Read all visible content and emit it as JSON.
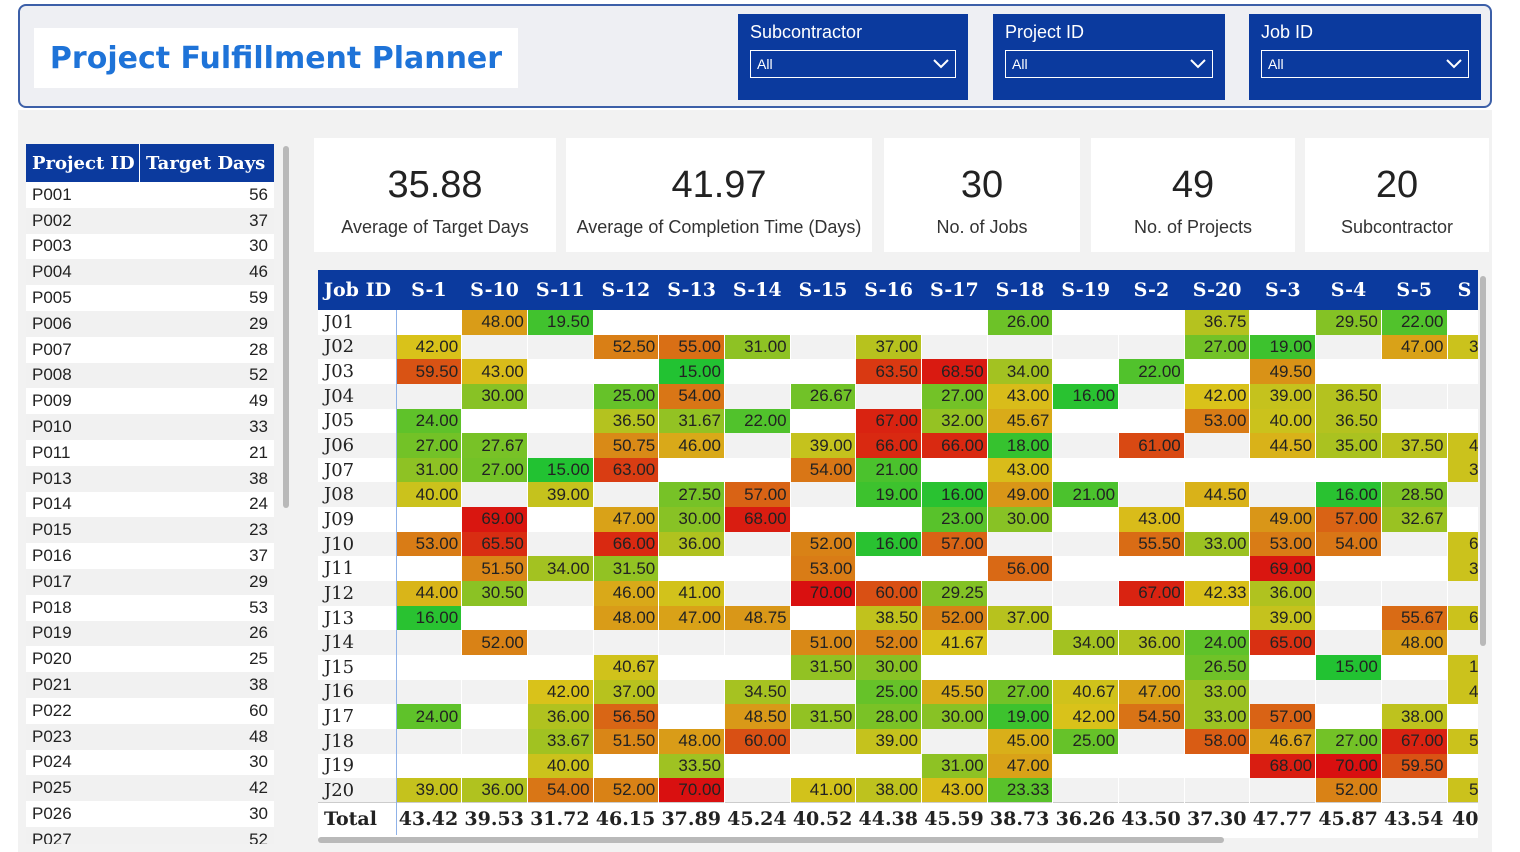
{
  "title": "Project Fulfillment Planner",
  "slicers": [
    {
      "label": "Subcontractor",
      "value": "All"
    },
    {
      "label": "Project ID",
      "value": "All"
    },
    {
      "label": "Job ID",
      "value": "All"
    }
  ],
  "project_table": {
    "headers": [
      "Project ID",
      "Target Days"
    ],
    "rows": [
      [
        "P001",
        "56"
      ],
      [
        "P002",
        "37"
      ],
      [
        "P003",
        "30"
      ],
      [
        "P004",
        "46"
      ],
      [
        "P005",
        "59"
      ],
      [
        "P006",
        "29"
      ],
      [
        "P007",
        "28"
      ],
      [
        "P008",
        "52"
      ],
      [
        "P009",
        "49"
      ],
      [
        "P010",
        "33"
      ],
      [
        "P011",
        "21"
      ],
      [
        "P013",
        "38"
      ],
      [
        "P014",
        "24"
      ],
      [
        "P015",
        "23"
      ],
      [
        "P016",
        "37"
      ],
      [
        "P017",
        "29"
      ],
      [
        "P018",
        "53"
      ],
      [
        "P019",
        "26"
      ],
      [
        "P020",
        "25"
      ],
      [
        "P021",
        "38"
      ],
      [
        "P022",
        "60"
      ],
      [
        "P023",
        "48"
      ],
      [
        "P024",
        "30"
      ],
      [
        "P025",
        "42"
      ],
      [
        "P026",
        "30"
      ],
      [
        "P027",
        "52"
      ]
    ]
  },
  "kpis": [
    {
      "value": "35.88",
      "label": "Average of Target Days"
    },
    {
      "value": "41.97",
      "label": "Average of Completion Time (Days)"
    },
    {
      "value": "30",
      "label": "No. of Jobs"
    },
    {
      "value": "49",
      "label": "No. of Projects"
    },
    {
      "value": "20",
      "label": "Subcontractor"
    }
  ],
  "matrix": {
    "corner": "Job ID",
    "columns": [
      "S-1",
      "S-10",
      "S-11",
      "S-12",
      "S-13",
      "S-14",
      "S-15",
      "S-16",
      "S-17",
      "S-18",
      "S-19",
      "S-2",
      "S-20",
      "S-3",
      "S-4",
      "S-5",
      "S"
    ],
    "rows": [
      {
        "job": "J01",
        "cells": [
          "",
          "48.00",
          "19.50",
          "",
          "",
          "",
          "",
          "",
          "",
          "26.00",
          "",
          "",
          "36.75",
          "",
          "29.50",
          "22.00",
          ""
        ]
      },
      {
        "job": "J02",
        "cells": [
          "42.00",
          "",
          "",
          "52.50",
          "55.00",
          "31.00",
          "",
          "37.00",
          "",
          "",
          "",
          "",
          "27.00",
          "19.00",
          "",
          "47.00",
          "3"
        ]
      },
      {
        "job": "J03",
        "cells": [
          "59.50",
          "43.00",
          "",
          "",
          "15.00",
          "",
          "",
          "63.50",
          "68.50",
          "34.00",
          "",
          "22.00",
          "",
          "49.50",
          "",
          "",
          ""
        ]
      },
      {
        "job": "J04",
        "cells": [
          "",
          "30.00",
          "",
          "25.00",
          "54.00",
          "",
          "26.67",
          "",
          "27.00",
          "43.00",
          "16.00",
          "",
          "42.00",
          "39.00",
          "36.50",
          "",
          ""
        ]
      },
      {
        "job": "J05",
        "cells": [
          "24.00",
          "",
          "",
          "36.50",
          "31.67",
          "22.00",
          "",
          "67.00",
          "32.00",
          "45.67",
          "",
          "",
          "53.00",
          "40.00",
          "36.50",
          "",
          ""
        ]
      },
      {
        "job": "J06",
        "cells": [
          "27.00",
          "27.67",
          "",
          "50.75",
          "46.00",
          "",
          "39.00",
          "66.00",
          "66.00",
          "18.00",
          "",
          "61.00",
          "",
          "44.50",
          "35.00",
          "37.50",
          "4"
        ]
      },
      {
        "job": "J07",
        "cells": [
          "31.00",
          "27.00",
          "15.00",
          "63.00",
          "",
          "",
          "54.00",
          "21.00",
          "",
          "43.00",
          "",
          "",
          "",
          "",
          "",
          "",
          "3"
        ]
      },
      {
        "job": "J08",
        "cells": [
          "40.00",
          "",
          "39.00",
          "",
          "27.50",
          "57.00",
          "",
          "19.00",
          "16.00",
          "49.00",
          "21.00",
          "",
          "44.50",
          "",
          "16.00",
          "28.50",
          ""
        ]
      },
      {
        "job": "J09",
        "cells": [
          "",
          "69.00",
          "",
          "47.00",
          "30.00",
          "68.00",
          "",
          "",
          "23.00",
          "30.00",
          "",
          "43.00",
          "",
          "49.00",
          "57.00",
          "32.67",
          ""
        ]
      },
      {
        "job": "J10",
        "cells": [
          "53.00",
          "65.50",
          "",
          "66.00",
          "36.00",
          "",
          "52.00",
          "16.00",
          "57.00",
          "",
          "",
          "55.50",
          "33.00",
          "53.00",
          "54.00",
          "",
          "6"
        ]
      },
      {
        "job": "J11",
        "cells": [
          "",
          "51.50",
          "34.00",
          "31.50",
          "",
          "",
          "53.00",
          "",
          "",
          "56.00",
          "",
          "",
          "",
          "69.00",
          "",
          "",
          "3"
        ]
      },
      {
        "job": "J12",
        "cells": [
          "44.00",
          "30.50",
          "",
          "46.00",
          "41.00",
          "",
          "70.00",
          "60.00",
          "29.25",
          "",
          "",
          "67.00",
          "42.33",
          "36.00",
          "",
          "",
          ""
        ]
      },
      {
        "job": "J13",
        "cells": [
          "16.00",
          "",
          "",
          "48.00",
          "47.00",
          "48.75",
          "",
          "38.50",
          "52.00",
          "37.00",
          "",
          "",
          "",
          "39.00",
          "",
          "55.67",
          "6"
        ]
      },
      {
        "job": "J14",
        "cells": [
          "",
          "52.00",
          "",
          "",
          "",
          "",
          "51.00",
          "52.00",
          "41.67",
          "",
          "34.00",
          "36.00",
          "24.00",
          "65.00",
          "",
          "48.00",
          ""
        ]
      },
      {
        "job": "J15",
        "cells": [
          "",
          "",
          "",
          "40.67",
          "",
          "",
          "31.50",
          "30.00",
          "",
          "",
          "",
          "",
          "26.50",
          "",
          "15.00",
          "",
          "1"
        ]
      },
      {
        "job": "J16",
        "cells": [
          "",
          "",
          "42.00",
          "37.00",
          "",
          "34.50",
          "",
          "25.00",
          "45.50",
          "27.00",
          "40.67",
          "47.00",
          "33.00",
          "",
          "",
          "",
          "4"
        ]
      },
      {
        "job": "J17",
        "cells": [
          "24.00",
          "",
          "36.00",
          "56.50",
          "",
          "48.50",
          "31.50",
          "28.00",
          "30.00",
          "19.00",
          "42.00",
          "54.50",
          "33.00",
          "57.00",
          "",
          "38.00",
          ""
        ]
      },
      {
        "job": "J18",
        "cells": [
          "",
          "",
          "33.67",
          "51.50",
          "48.00",
          "60.00",
          "",
          "39.00",
          "",
          "45.00",
          "25.00",
          "",
          "58.00",
          "46.67",
          "27.00",
          "67.00",
          "5"
        ]
      },
      {
        "job": "J19",
        "cells": [
          "",
          "",
          "40.00",
          "",
          "33.50",
          "",
          "",
          "",
          "31.00",
          "47.00",
          "",
          "",
          "",
          "68.00",
          "70.00",
          "59.50",
          ""
        ]
      },
      {
        "job": "J20",
        "cells": [
          "39.00",
          "36.00",
          "54.00",
          "52.00",
          "70.00",
          "",
          "41.00",
          "38.00",
          "43.00",
          "23.33",
          "",
          "",
          "",
          "",
          "52.00",
          "",
          "5"
        ]
      }
    ],
    "total_label": "Total",
    "totals": [
      "43.42",
      "39.53",
      "31.72",
      "46.15",
      "37.89",
      "45.24",
      "40.52",
      "44.38",
      "45.59",
      "38.73",
      "36.26",
      "43.50",
      "37.30",
      "47.77",
      "45.87",
      "43.54",
      "40"
    ]
  },
  "colors": {
    "header_blue": "#0b3a9e",
    "title_blue": "#1e73d8",
    "scale_low": "#22c232",
    "scale_mid": "#d9c21a",
    "scale_high": "#d91010"
  }
}
